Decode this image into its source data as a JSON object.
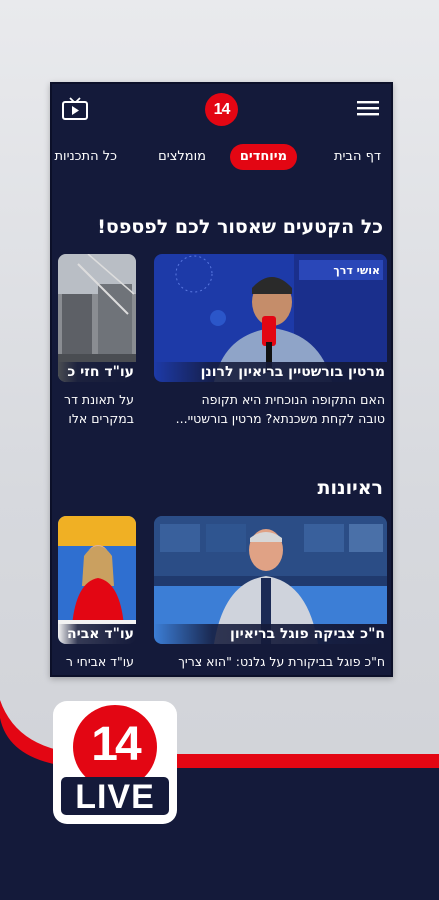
{
  "header": {
    "logo_text": "14",
    "tv_icon": "tv-icon",
    "menu_icon": "hamburger-menu-icon"
  },
  "tabs": [
    {
      "label": "דף הבית",
      "active": false
    },
    {
      "label": "מיוחדים",
      "active": true
    },
    {
      "label": "מומלצים",
      "active": false
    },
    {
      "label": "כל התכניות",
      "active": false
    }
  ],
  "sections": [
    {
      "title": "כל הקטעים שאסור לכם לפספס!",
      "cards": [
        {
          "title": "מרטין בורשטיין בריאיון לרונן",
          "description_lines": [
            "האם התקופה הנוכחית היא תקופה",
            "טובה לקחת משכנתא? מרטין בורשטיי..."
          ],
          "thumb_overlay": "אושי דרך"
        },
        {
          "title": "עו\"ד חזי כ",
          "description_lines": [
            "על תאונת דר",
            "במקרים אלו"
          ],
          "thumb_overlay": ""
        }
      ]
    },
    {
      "title": "ראיונות",
      "cards": [
        {
          "title": "ח\"כ צביקה פוגל בריאיון",
          "description_lines": [
            "ח\"כ פוגל בביקורת על גלנט: \"הוא צריך"
          ],
          "thumb_overlay": ""
        },
        {
          "title": "עו\"ד אביה",
          "description_lines": [
            "עו\"ד אביחי ר"
          ],
          "thumb_overlay": ""
        }
      ]
    }
  ],
  "app_logo": {
    "number": "14",
    "live": "LIVE"
  },
  "colors": {
    "brand_red": "#e30613",
    "navy": "#141a3a"
  }
}
